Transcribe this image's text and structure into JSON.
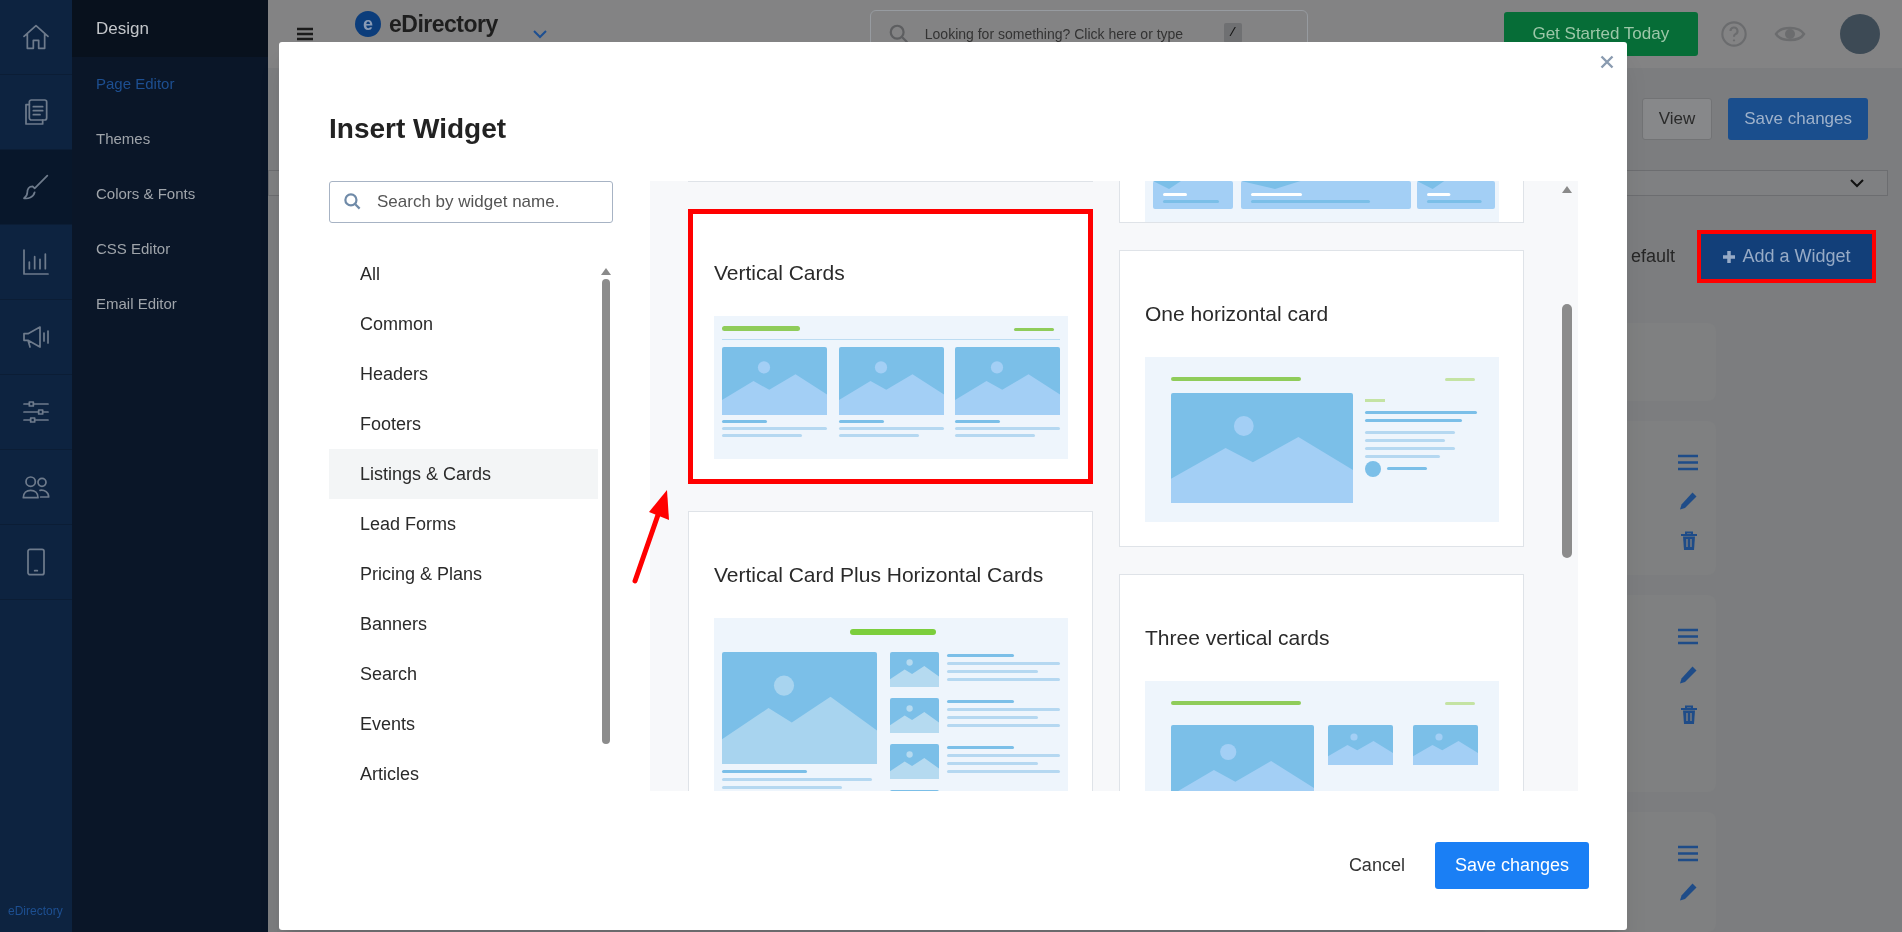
{
  "rail": {
    "items": [
      {
        "selected": false
      },
      {
        "selected": false
      },
      {
        "selected": true
      },
      {
        "selected": false
      },
      {
        "selected": false
      },
      {
        "selected": false
      },
      {
        "selected": false
      },
      {
        "selected": false
      }
    ],
    "footer": "eDirectory"
  },
  "sidebar": {
    "title": "Design",
    "items": [
      {
        "label": "Page Editor",
        "selected": true
      },
      {
        "label": "Themes",
        "selected": false
      },
      {
        "label": "Colors & Fonts",
        "selected": false
      },
      {
        "label": "CSS Editor",
        "selected": false
      },
      {
        "label": "Email Editor",
        "selected": false
      }
    ]
  },
  "topbar": {
    "logo": {
      "mark": "e",
      "name": "eDirectory"
    },
    "search": {
      "placeholder": "Looking for something? Click here or type",
      "shortcut": "/"
    },
    "cta": "Get Started Today"
  },
  "toolbar": {
    "buttons": [
      {
        "label": "View",
        "kind": "secondary"
      },
      {
        "label": "Save changes",
        "kind": "primary"
      }
    ]
  },
  "section": {
    "label": "efault",
    "add_button": {
      "label": "Add a Widget",
      "highlighted": true
    }
  },
  "modal": {
    "title": "Insert Widget",
    "search": {
      "placeholder": "Search by widget name."
    },
    "categories": [
      {
        "label": "All",
        "selected": false
      },
      {
        "label": "Common",
        "selected": false
      },
      {
        "label": "Headers",
        "selected": false
      },
      {
        "label": "Footers",
        "selected": false
      },
      {
        "label": "Listings & Cards",
        "selected": true
      },
      {
        "label": "Lead Forms",
        "selected": false
      },
      {
        "label": "Pricing & Plans",
        "selected": false
      },
      {
        "label": "Banners",
        "selected": false
      },
      {
        "label": "Search",
        "selected": false
      },
      {
        "label": "Events",
        "selected": false
      },
      {
        "label": "Articles",
        "selected": false
      }
    ],
    "gallery": {
      "columns": [
        [
          {
            "kind": "stub",
            "highlighted": false
          },
          {
            "title": "Vertical Cards",
            "kind": "vertical-cards",
            "highlighted": true
          },
          {
            "title": "Vertical Card Plus Horizontal Cards",
            "kind": "vertical-plus-horizontal",
            "highlighted": false
          }
        ],
        [
          {
            "kind": "strip",
            "highlighted": false
          },
          {
            "title": "One horizontal card",
            "kind": "horizontal-card",
            "highlighted": false
          },
          {
            "title": "Three vertical cards",
            "kind": "three-vertical",
            "highlighted": false
          }
        ]
      ]
    },
    "annotations": [
      {
        "kind": "arrow"
      }
    ],
    "buttons": [
      {
        "label": "Cancel",
        "kind": "link"
      },
      {
        "label": "Save changes",
        "kind": "primary"
      }
    ]
  }
}
